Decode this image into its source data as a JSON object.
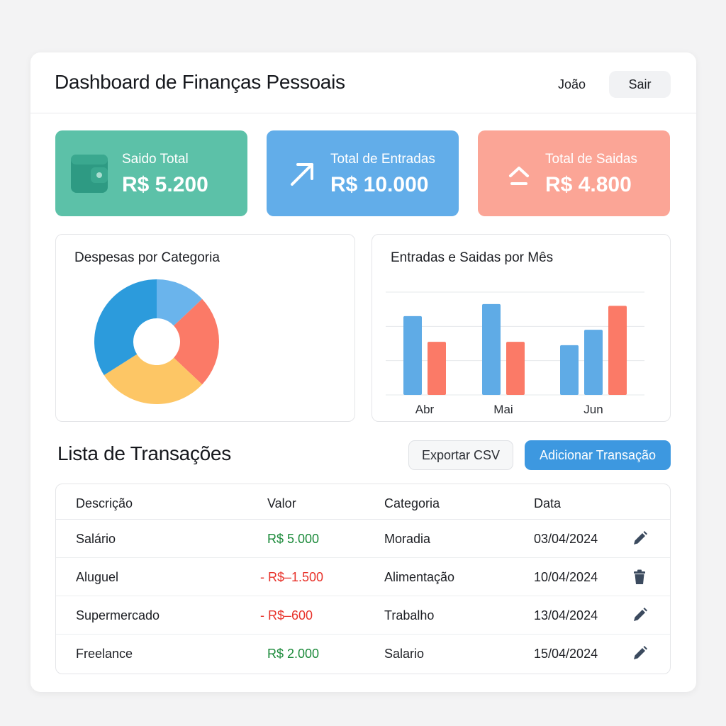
{
  "header": {
    "title": "Dashboard de Finanças Pessoais",
    "user": "João",
    "logout_label": "Sair"
  },
  "summary_cards": [
    {
      "label": "Saido Total",
      "value": "R$ 5.200",
      "icon": "wallet-icon",
      "color": "#5cc1a8"
    },
    {
      "label": "Total de Entradas",
      "value": "R$ 10.000",
      "icon": "arrow-up-right-icon",
      "color": "#62ade9"
    },
    {
      "label": "Total de Saidas",
      "value": "R$ 4.800",
      "icon": "chevron-up-minus-icon",
      "color": "#fba596"
    }
  ],
  "expenses_panel": {
    "title": "Despesas por Categoria"
  },
  "monthly_panel": {
    "title": "Entradas e Saidas por Mês"
  },
  "chart_data": [
    {
      "type": "pie",
      "variant": "donut",
      "title": "Despesas por Categoria",
      "values": [
        13,
        24,
        29,
        34
      ],
      "colors": [
        "#6ab4ec",
        "#fb7a67",
        "#fdc665",
        "#2c9bdc"
      ],
      "legend": "none"
    },
    {
      "type": "bar",
      "title": "Entradas e Saidas por Mês",
      "categories": [
        "Abr",
        "Mai",
        "Jun"
      ],
      "ylim": [
        0,
        3
      ],
      "grid": true,
      "series": [
        {
          "values": [
            2.3,
            2.65
          ],
          "color": "#5fabe6"
        },
        {
          "values": [
            1.55,
            1.55
          ],
          "color": "#fb7a67"
        }
      ],
      "jun_values": [
        1.45,
        1.9,
        2.6
      ],
      "jun_colors": [
        "#5fabe6",
        "#5fabe6",
        "#fb7a67"
      ]
    }
  ],
  "transactions": {
    "title": "Lista de Transações",
    "export_label": "Exportar CSV",
    "add_label": "Adicionar Transação",
    "columns": [
      "Descrição",
      "Valor",
      "Categoria",
      "Data"
    ],
    "rows": [
      {
        "description": "Salário",
        "value": "R$ 5.000",
        "kind": "pos",
        "category": "Moradia",
        "date": "03/04/2024",
        "action": "pencil-icon"
      },
      {
        "description": "Aluguel",
        "value": "- R$–1.500",
        "kind": "neg",
        "category": "Alimentação",
        "date": "10/04/2024",
        "action": "trash-icon"
      },
      {
        "description": "Supermercado",
        "value": "- R$–600",
        "kind": "neg",
        "category": "Trabalho",
        "date": "13/04/2024",
        "action": "pencil-icon"
      },
      {
        "description": "Freelance",
        "value": "R$ 2.000",
        "kind": "pos",
        "category": "Salario",
        "date": "15/04/2024",
        "action": "pencil-icon"
      }
    ]
  },
  "colors": {
    "positive": "#1b8a3a",
    "negative": "#e8332b",
    "primary_button": "#3d98e0"
  }
}
